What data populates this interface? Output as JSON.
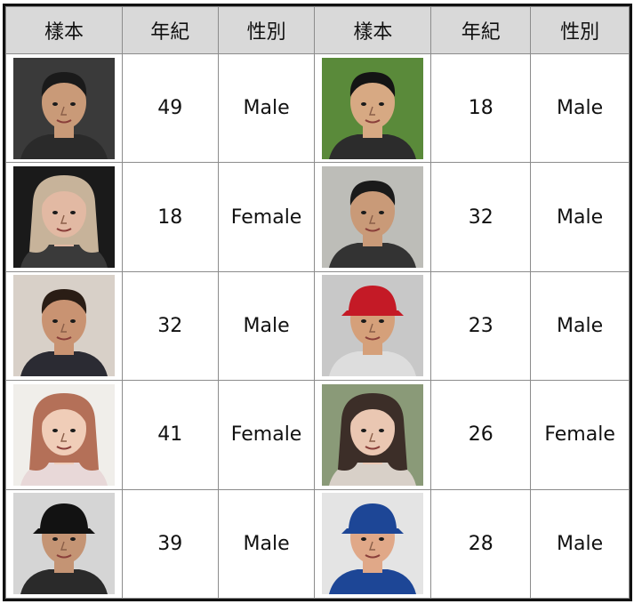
{
  "headers": [
    "樣本",
    "年紀",
    "性別",
    "樣本",
    "年紀",
    "性別"
  ],
  "rows": [
    {
      "left": {
        "age": "49",
        "gender": "Male",
        "photo": "face-man-spiky-hair",
        "bg": "#3a3a3a",
        "skin": "#c99a78",
        "hair": "#1a1a1a",
        "shirt": "#2a2a2a"
      },
      "right": {
        "age": "18",
        "gender": "Male",
        "photo": "face-young-man",
        "bg": "#5a8a3a",
        "skin": "#d7a983",
        "hair": "#141414",
        "shirt": "#2c2c2c"
      }
    },
    {
      "left": {
        "age": "18",
        "gender": "Female",
        "photo": "face-woman-blonde",
        "bg": "#1a1a1a",
        "skin": "#e2b9a3",
        "hair": "#c7b39a",
        "shirt": "#3a3a3a"
      },
      "right": {
        "age": "32",
        "gender": "Male",
        "photo": "face-man-glasses",
        "bg": "#bdbdb8",
        "skin": "#c99a78",
        "hair": "#1a1a1a",
        "shirt": "#333333"
      }
    },
    {
      "left": {
        "age": "32",
        "gender": "Male",
        "photo": "face-man-dark-hair",
        "bg": "#d8d0c8",
        "skin": "#c99372",
        "hair": "#2a1d15",
        "shirt": "#2b2b33"
      },
      "right": {
        "age": "23",
        "gender": "Male",
        "photo": "face-man-red-cap",
        "bg": "#c8c8c8",
        "skin": "#d5a07a",
        "hair": "#c41a26",
        "shirt": "#dddddd"
      }
    },
    {
      "left": {
        "age": "41",
        "gender": "Female",
        "photo": "face-woman-pigtails",
        "bg": "#f0eeea",
        "skin": "#f0cdb8",
        "hair": "#b47058",
        "shirt": "#e8d8d8"
      },
      "right": {
        "age": "26",
        "gender": "Female",
        "photo": "face-woman-long-hair",
        "bg": "#8a9a78",
        "skin": "#eac7b2",
        "hair": "#3c2e28",
        "shirt": "#d8d0c8"
      }
    },
    {
      "left": {
        "age": "39",
        "gender": "Male",
        "photo": "face-man-ny-cap",
        "bg": "#d5d5d5",
        "skin": "#c49474",
        "hair": "#121212",
        "shirt": "#2a2a2a"
      },
      "right": {
        "age": "28",
        "gender": "Male",
        "photo": "face-man-la-cap",
        "bg": "#e4e4e4",
        "skin": "#e0a888",
        "hair": "#1d4696",
        "shirt": "#1d4696"
      }
    }
  ]
}
